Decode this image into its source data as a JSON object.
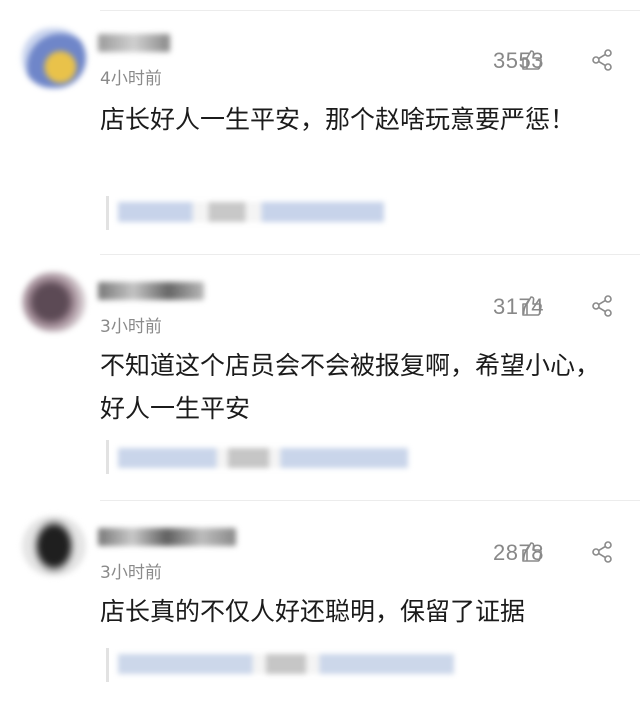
{
  "comments": [
    {
      "time": "4小时前",
      "likes": "3553",
      "text": "店长好人一生平安，那个赵啥玩意要严惩！"
    },
    {
      "time": "3小时前",
      "likes": "3174",
      "text": "不知道这个店员会不会被报复啊，希望小心，好人一生平安"
    },
    {
      "time": "3小时前",
      "likes": "2878",
      "text": "店长真的不仅人好还聪明，保留了证据"
    }
  ],
  "icons": {
    "like": "thumbs-up-icon",
    "share": "share-icon"
  },
  "colors": {
    "text": "#1b1b1b",
    "meta": "#8a8a8a",
    "reply_link": "#5d7fb7"
  }
}
